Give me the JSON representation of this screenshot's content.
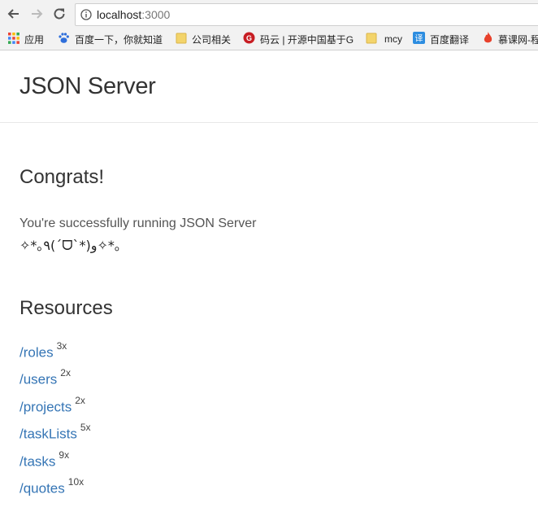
{
  "browser": {
    "url_host": "localhost",
    "url_port": ":3000",
    "bookmarks": [
      {
        "label": "应用",
        "icon": "apps-grid-icon"
      },
      {
        "label": "百度一下，你就知道",
        "icon": "baidu-paw-icon"
      },
      {
        "label": "公司相关",
        "icon": "folder-icon"
      },
      {
        "label": "码云 | 开源中国基于G",
        "icon": "gitee-icon"
      },
      {
        "label": "mcy",
        "icon": "folder-icon"
      },
      {
        "label": "百度翻译",
        "icon": "translate-icon"
      },
      {
        "label": "慕课网-程",
        "icon": "imooc-flame-icon"
      }
    ]
  },
  "page": {
    "title": "JSON Server",
    "congrats_heading": "Congrats!",
    "description": "You're successfully running JSON Server",
    "kaomoji": "✧*｡٩(ˊᗜˋ*)و✧*｡",
    "resources_heading": "Resources",
    "resources": [
      {
        "path": "/roles",
        "count": "3x"
      },
      {
        "path": "/users",
        "count": "2x"
      },
      {
        "path": "/projects",
        "count": "2x"
      },
      {
        "path": "/taskLists",
        "count": "5x"
      },
      {
        "path": "/tasks",
        "count": "9x"
      },
      {
        "path": "/quotes",
        "count": "10x"
      }
    ]
  },
  "colors": {
    "link": "#3575b5",
    "heading": "#333333",
    "toolbar_bg": "#f2f2f2"
  }
}
